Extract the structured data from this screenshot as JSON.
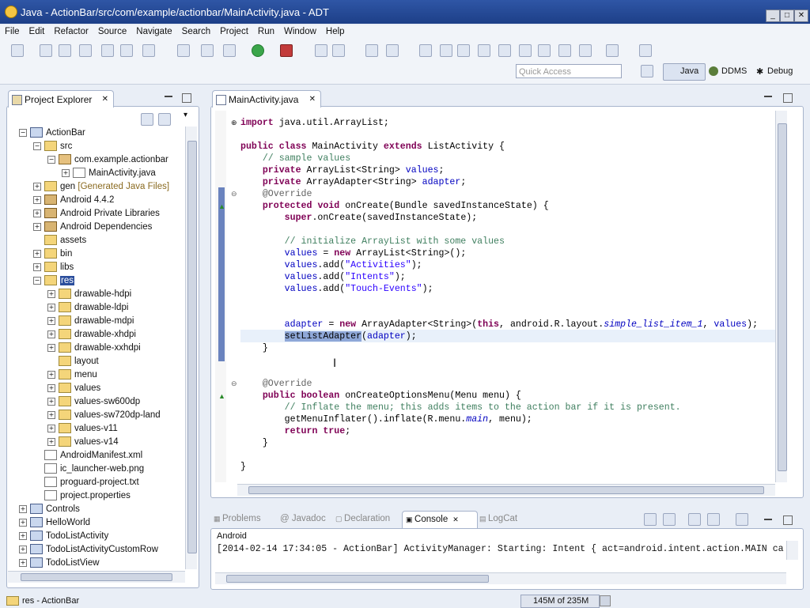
{
  "window": {
    "title": "Java - ActionBar/src/com/example/actionbar/MainActivity.java - ADT"
  },
  "menu": [
    "File",
    "Edit",
    "Refactor",
    "Source",
    "Navigate",
    "Search",
    "Project",
    "Run",
    "Window",
    "Help"
  ],
  "toolbar": {
    "quick_access_placeholder": "Quick Access",
    "perspectives": [
      "Java",
      "DDMS",
      "Debug"
    ]
  },
  "explorer": {
    "tab_label": "Project Explorer",
    "items": [
      {
        "label": "ActionBar",
        "kind": "proj",
        "expanded": true
      },
      {
        "label": "src",
        "kind": "folder",
        "expanded": true
      },
      {
        "label": "com.example.actionbar",
        "kind": "pkg",
        "expanded": true
      },
      {
        "label": "MainActivity.java",
        "kind": "file",
        "expanded": false
      },
      {
        "label": "gen",
        "kind": "folder",
        "note": "[Generated Java Files]",
        "expanded": false
      },
      {
        "label": "Android 4.4.2",
        "kind": "lib",
        "expanded": false
      },
      {
        "label": "Android Private Libraries",
        "kind": "lib",
        "expanded": false
      },
      {
        "label": "Android Dependencies",
        "kind": "lib",
        "expanded": false
      },
      {
        "label": "assets",
        "kind": "folder",
        "expanded": null
      },
      {
        "label": "bin",
        "kind": "folder",
        "expanded": false
      },
      {
        "label": "libs",
        "kind": "folder",
        "expanded": false
      },
      {
        "label": "res",
        "kind": "folder",
        "expanded": true,
        "selected": true
      },
      {
        "label": "drawable-hdpi",
        "kind": "folder",
        "expanded": false
      },
      {
        "label": "drawable-ldpi",
        "kind": "folder",
        "expanded": false
      },
      {
        "label": "drawable-mdpi",
        "kind": "folder",
        "expanded": false
      },
      {
        "label": "drawable-xhdpi",
        "kind": "folder",
        "expanded": false
      },
      {
        "label": "drawable-xxhdpi",
        "kind": "folder",
        "expanded": false
      },
      {
        "label": "layout",
        "kind": "folder",
        "expanded": null
      },
      {
        "label": "menu",
        "kind": "folder",
        "expanded": false
      },
      {
        "label": "values",
        "kind": "folder",
        "expanded": false
      },
      {
        "label": "values-sw600dp",
        "kind": "folder",
        "expanded": false
      },
      {
        "label": "values-sw720dp-land",
        "kind": "folder",
        "expanded": false
      },
      {
        "label": "values-v11",
        "kind": "folder",
        "expanded": false
      },
      {
        "label": "values-v14",
        "kind": "folder",
        "expanded": false
      },
      {
        "label": "AndroidManifest.xml",
        "kind": "file",
        "expanded": null
      },
      {
        "label": "ic_launcher-web.png",
        "kind": "file",
        "expanded": null
      },
      {
        "label": "proguard-project.txt",
        "kind": "file",
        "expanded": null
      },
      {
        "label": "project.properties",
        "kind": "file",
        "expanded": null
      },
      {
        "label": "Controls",
        "kind": "proj",
        "expanded": false
      },
      {
        "label": "HelloWorld",
        "kind": "proj",
        "expanded": false
      },
      {
        "label": "TodoListActivity",
        "kind": "proj",
        "expanded": false
      },
      {
        "label": "TodoListActivityCustomRow",
        "kind": "proj",
        "expanded": false
      },
      {
        "label": "TodoListView",
        "kind": "proj",
        "expanded": false
      }
    ]
  },
  "editor": {
    "tab_label": "MainActivity.java",
    "lines": [
      "import java.util.ArrayList;",
      "",
      "public class MainActivity extends ListActivity {",
      "    // sample values",
      "    private ArrayList<String> values;",
      "    private ArrayAdapter<String> adapter;",
      "    @Override",
      "    protected void onCreate(Bundle savedInstanceState) {",
      "        super.onCreate(savedInstanceState);",
      "",
      "        // initialize ArrayList with some values",
      "        values = new ArrayList<String>();",
      "        values.add(\"Activities\");",
      "        values.add(\"Intents\");",
      "        values.add(\"Touch-Events\");",
      "",
      "",
      "        adapter = new ArrayAdapter<String>(this, android.R.layout.simple_list_item_1, values);",
      "        setListAdapter(adapter);",
      "    }",
      "",
      "",
      "    @Override",
      "    public boolean onCreateOptionsMenu(Menu menu) {",
      "        // Inflate the menu; this adds items to the action bar if it is present.",
      "        getMenuInflater().inflate(R.menu.main, menu);",
      "        return true;",
      "    }",
      "",
      "}"
    ]
  },
  "bottom": {
    "tabs": [
      "Problems",
      "Javadoc",
      "Declaration",
      "Console",
      "LogCat"
    ],
    "active_tab": "Console",
    "console_header": "Android",
    "console_line": "[2014-02-14 17:34:05 - ActionBar] ActivityManager: Starting: Intent { act=android.intent.action.MAIN ca"
  },
  "status": {
    "left": "res - ActionBar",
    "memory": "145M of 235M"
  },
  "colors": {
    "titlebar": "#2f56a6",
    "selection": "#2b4e9c",
    "keyword": "#7f0055",
    "comment": "#3f7f5f",
    "string": "#2a00ff",
    "field": "#0000c0"
  }
}
